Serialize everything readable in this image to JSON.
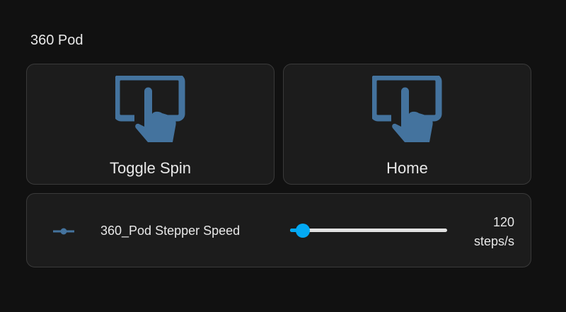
{
  "section": {
    "title": "360 Pod"
  },
  "buttons": [
    {
      "label": "Toggle Spin",
      "icon": "gesture-tap-button-icon"
    },
    {
      "label": "Home",
      "icon": "gesture-tap-button-icon"
    }
  ],
  "slider": {
    "name": "360_Pod Stepper Speed",
    "icon": "ray-vertex-icon",
    "value": "120",
    "unit": "steps/s",
    "fraction": 0.08
  },
  "colors": {
    "background": "#111111",
    "card": "#1c1c1c",
    "icon": "#44739e",
    "accent": "#03a9f4",
    "track": "#e2e2e2"
  }
}
